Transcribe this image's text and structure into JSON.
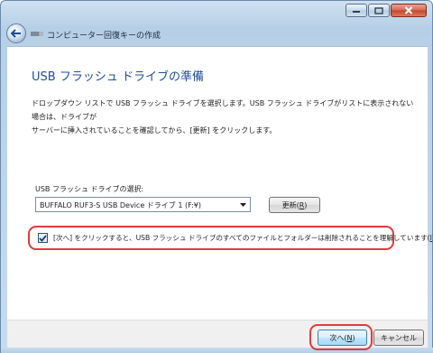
{
  "nav": {
    "title": "コンピューター回復キーの作成"
  },
  "page": {
    "heading": "USB フラッシュ ドライブの準備",
    "description_line1": "ドロップダウン リストで USB フラッシュ ドライブを選択します。USB フラッシュ ドライブがリストに表示されない場合は、ドライブが",
    "description_line2": "サーバーに挿入されていることを確認してから、[更新] をクリックします。"
  },
  "drive": {
    "label": "USB フラッシュ ドライブの選択:",
    "selected": "BUFFALO RUF3-S USB Device ドライブ 1 (F:¥)"
  },
  "refresh": {
    "label": "更新(",
    "accel": "R",
    "suffix": ")"
  },
  "confirm": {
    "checked": true,
    "label": "[次へ] をクリックすると、USB フラッシュ ドライブのすべてのファイルとフォルダーは削除されることを理解しています(",
    "accel": "I",
    "suffix": ")"
  },
  "buttons": {
    "next_label": "次へ(",
    "next_accel": "N",
    "next_suffix": ")",
    "cancel_label": "キャンセル"
  },
  "colors": {
    "heading": "#1f4e9c",
    "highlight": "#e23a3a",
    "close_button": "#c3432a"
  },
  "icons": [
    "minimize-icon",
    "maximize-icon",
    "close-icon",
    "back-arrow-icon",
    "usb-drive-icon",
    "dropdown-arrow-icon",
    "checkmark-icon"
  ]
}
